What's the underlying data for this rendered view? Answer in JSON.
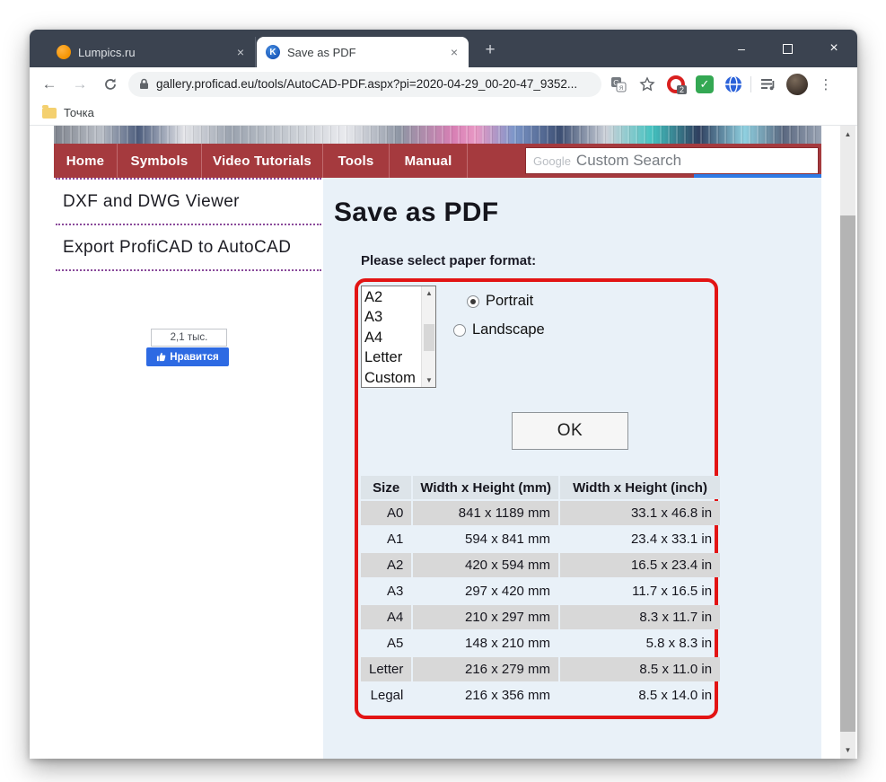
{
  "browser": {
    "tabs": [
      {
        "title": "Lumpics.ru",
        "close": "×"
      },
      {
        "title": "Save as PDF",
        "close": "×"
      }
    ],
    "new_tab_label": "+",
    "window_controls": {
      "minimize": "–",
      "close": "×"
    },
    "url": "gallery.proficad.eu/tools/AutoCAD-PDF.aspx?pi=2020-04-29_00-20-47_9352...",
    "extension_badge": "2",
    "bookmark_label": "Точка",
    "favicon_letter": "K"
  },
  "site": {
    "nav": {
      "items": [
        "Home",
        "Symbols",
        "Video Tutorials",
        "Tools",
        "Manual"
      ],
      "search_watermark": "Google",
      "search_placeholder": "Custom Search"
    },
    "sidebar": {
      "links": [
        "DXF and DWG Viewer",
        "Export ProfiCAD to AutoCAD"
      ],
      "fb_count": "2,1 тыс.",
      "fb_like_label": "Нравится"
    },
    "main": {
      "title": "Save as PDF",
      "prompt": "Please select paper format:",
      "paper_options": [
        "A2",
        "A3",
        "A4",
        "Letter",
        "Custom"
      ],
      "orientation": {
        "portrait": "Portrait",
        "landscape": "Landscape",
        "selected": "Portrait"
      },
      "ok_label": "OK",
      "table": {
        "headers": [
          "Size",
          "Width x Height (mm)",
          "Width x Height (inch)"
        ],
        "rows": [
          [
            "A0",
            "841 x 1189 mm",
            "33.1 x 46.8 in"
          ],
          [
            "A1",
            "594 x 841 mm",
            "23.4 x 33.1 in"
          ],
          [
            "A2",
            "420 x 594 mm",
            "16.5 x 23.4 in"
          ],
          [
            "A3",
            "297 x 420 mm",
            "11.7 x 16.5 in"
          ],
          [
            "A4",
            "210 x 297 mm",
            "8.3 x 11.7 in"
          ],
          [
            "A5",
            "148 x 210 mm",
            "5.8 x 8.3 in"
          ],
          [
            "Letter",
            "216 x 279 mm",
            "8.5 x 11.0 in"
          ],
          [
            "Legal",
            "216 x 356 mm",
            "8.5 x 14.0 in"
          ]
        ]
      }
    },
    "colors": {
      "annotation_red": "#e21414",
      "nav_red": "#a53a3e",
      "content_bg": "#e9f1f8",
      "fb_blue": "#2d6ae3"
    }
  }
}
